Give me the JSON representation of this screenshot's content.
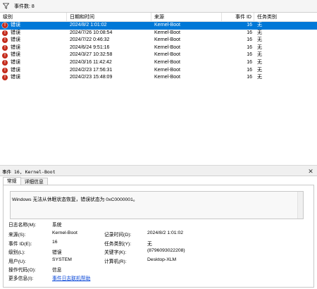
{
  "topbar": {
    "filter_icon": "filter-icon",
    "count_label": "事件数: 8"
  },
  "list": {
    "columns": [
      "级别",
      "日期和时间",
      "来源",
      "事件 ID",
      "任务类别"
    ],
    "rows": [
      {
        "level": "错误",
        "datetime": "2024/8/2 1:01:02",
        "source": "Kernel-Boot",
        "id": "16",
        "task": "无",
        "selected": true
      },
      {
        "level": "错误",
        "datetime": "2024/7/26 10:08:54",
        "source": "Kernel-Boot",
        "id": "16",
        "task": "无"
      },
      {
        "level": "错误",
        "datetime": "2024/7/22 0:46:32",
        "source": "Kernel-Boot",
        "id": "16",
        "task": "无"
      },
      {
        "level": "错误",
        "datetime": "2024/6/24 9:51:16",
        "source": "Kernel-Boot",
        "id": "16",
        "task": "无"
      },
      {
        "level": "错误",
        "datetime": "2024/3/27 10:32:58",
        "source": "Kernel-Boot",
        "id": "16",
        "task": "无"
      },
      {
        "level": "错误",
        "datetime": "2024/3/16 11:42:42",
        "source": "Kernel-Boot",
        "id": "16",
        "task": "无"
      },
      {
        "level": "错误",
        "datetime": "2024/2/23 17:56:31",
        "source": "Kernel-Boot",
        "id": "16",
        "task": "无"
      },
      {
        "level": "错误",
        "datetime": "2024/2/23 15:48:09",
        "source": "Kernel-Boot",
        "id": "16",
        "task": "无"
      }
    ]
  },
  "details": {
    "title": "事件 16, Kernel-Boot",
    "tabs": [
      "常规",
      "详细信息"
    ],
    "description": "Windows 无法从休眠状态恢复，错误状态为 0xC0000001。",
    "props": {
      "log_name_label": "日志名称(M):",
      "log_name": "系统",
      "source_label": "来源(S):",
      "source": "Kernel-Boot",
      "logged_label": "记录时间(D):",
      "logged": "2024/8/2 1:01:02",
      "event_id_label": "事件 ID(E):",
      "event_id": "16",
      "task_label": "任务类别(Y):",
      "task": "无",
      "level_label": "级别(L):",
      "level": "错误",
      "keywords_label": "关键字(K):",
      "keywords": "(8796093022208)",
      "user_label": "用户(U):",
      "user": "SYSTEM",
      "computer_label": "计算机(R):",
      "computer": "Desktop-XLM",
      "opcode_label": "操作代码(O):",
      "opcode": "信息",
      "more_info_label": "更多信息(I):",
      "more_info_link": "事件日志联机帮助"
    }
  },
  "colors": {
    "selection": "#0078d7",
    "error": "#c42b1c",
    "link": "#0645d8"
  }
}
